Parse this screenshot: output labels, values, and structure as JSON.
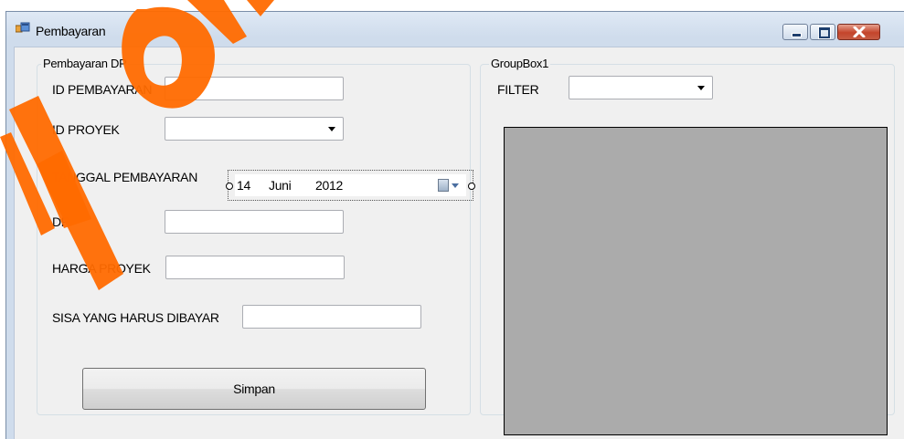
{
  "window": {
    "title": "Pembayaran",
    "icon": "form-icon",
    "controls": [
      "minimize-icon",
      "maximize-icon",
      "close-icon"
    ]
  },
  "pembayaran_group": {
    "legend": "Pembayaran DP",
    "id_pembayaran": {
      "label": "ID PEMBAYARAN",
      "value": ""
    },
    "id_proyek": {
      "label": "ID PROYEK",
      "value": ""
    },
    "tanggal_pembayaran": {
      "label": "TANGGAL PEMBAYARAN",
      "day": "14",
      "month": "Juni",
      "year": "2012"
    },
    "dp": {
      "label": "DP",
      "value": ""
    },
    "harga_proyek": {
      "label": "HARGA PROYEK",
      "value": ""
    },
    "sisa": {
      "label": "SISA YANG HARUS DIBAYAR",
      "value": ""
    },
    "save_label": "Simpan"
  },
  "filter_group": {
    "legend": "GroupBox1",
    "filter_label": "FILTER",
    "filter_value": ""
  },
  "colors": {
    "watermark": "#ff6a00",
    "grid_background": "#ababab",
    "client_background": "#f0f0f0"
  }
}
